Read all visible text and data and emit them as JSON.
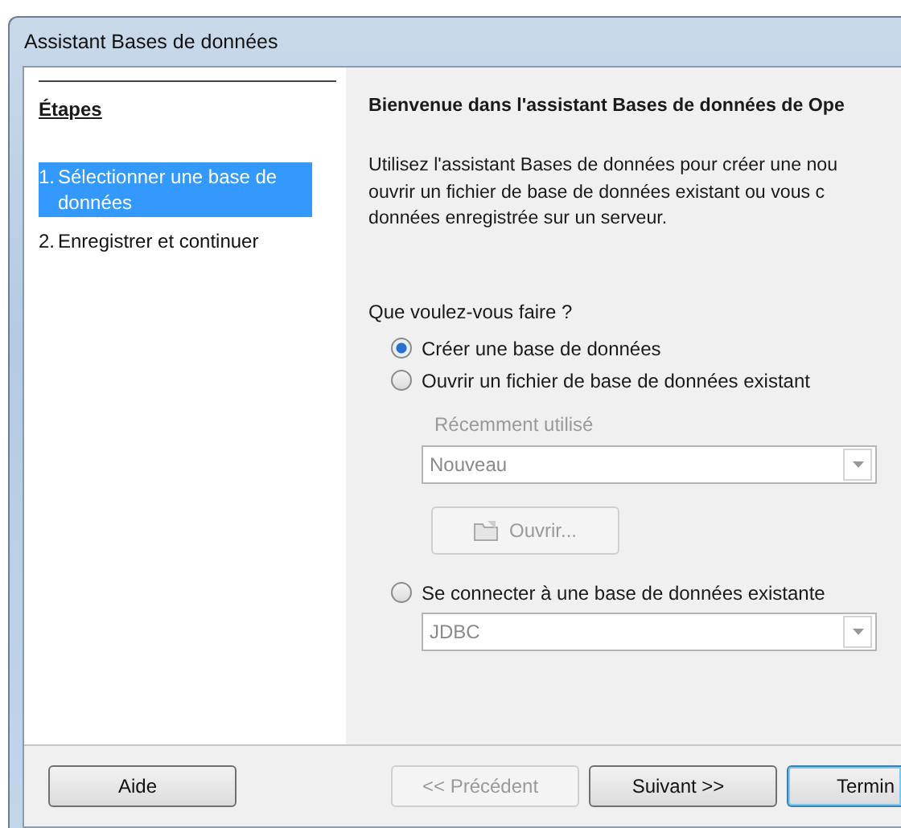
{
  "window": {
    "title": "Assistant Bases de données"
  },
  "steps": {
    "heading": "Étapes",
    "items": [
      {
        "number": "1.",
        "label": "Sélectionner une base de données",
        "selected": true
      },
      {
        "number": "2.",
        "label": "Enregistrer et continuer",
        "selected": false
      }
    ]
  },
  "content": {
    "heading": "Bienvenue dans l'assistant Bases de données de Ope",
    "paragraph_lines": [
      "Utilisez l'assistant Bases de données pour créer une nou",
      "ouvrir un fichier de base de données existant ou vous c",
      "données enregistrée sur un serveur."
    ],
    "question": "Que voulez-vous faire ?",
    "options": [
      {
        "kind": "radio",
        "label": "Créer une base de données",
        "selected": true
      },
      {
        "kind": "radio",
        "label": "Ouvrir un fichier de base de données existant",
        "selected": false
      },
      {
        "kind": "label",
        "label": "Récemment utilisé",
        "disabled": true
      },
      {
        "kind": "combo",
        "value": "Nouveau",
        "disabled": true
      },
      {
        "kind": "button",
        "label": "Ouvrir...",
        "disabled": true
      },
      {
        "kind": "radio",
        "label": "Se connecter à une base de données existante",
        "selected": false
      },
      {
        "kind": "combo",
        "value": "JDBC",
        "disabled": true
      }
    ]
  },
  "buttons": [
    {
      "label": "Aide",
      "disabled": false,
      "default": false
    },
    {
      "label": "<< Précédent",
      "disabled": true,
      "default": false
    },
    {
      "label": "Suivant >>",
      "disabled": false,
      "default": false
    },
    {
      "label": "Termin",
      "disabled": false,
      "default": true
    }
  ]
}
